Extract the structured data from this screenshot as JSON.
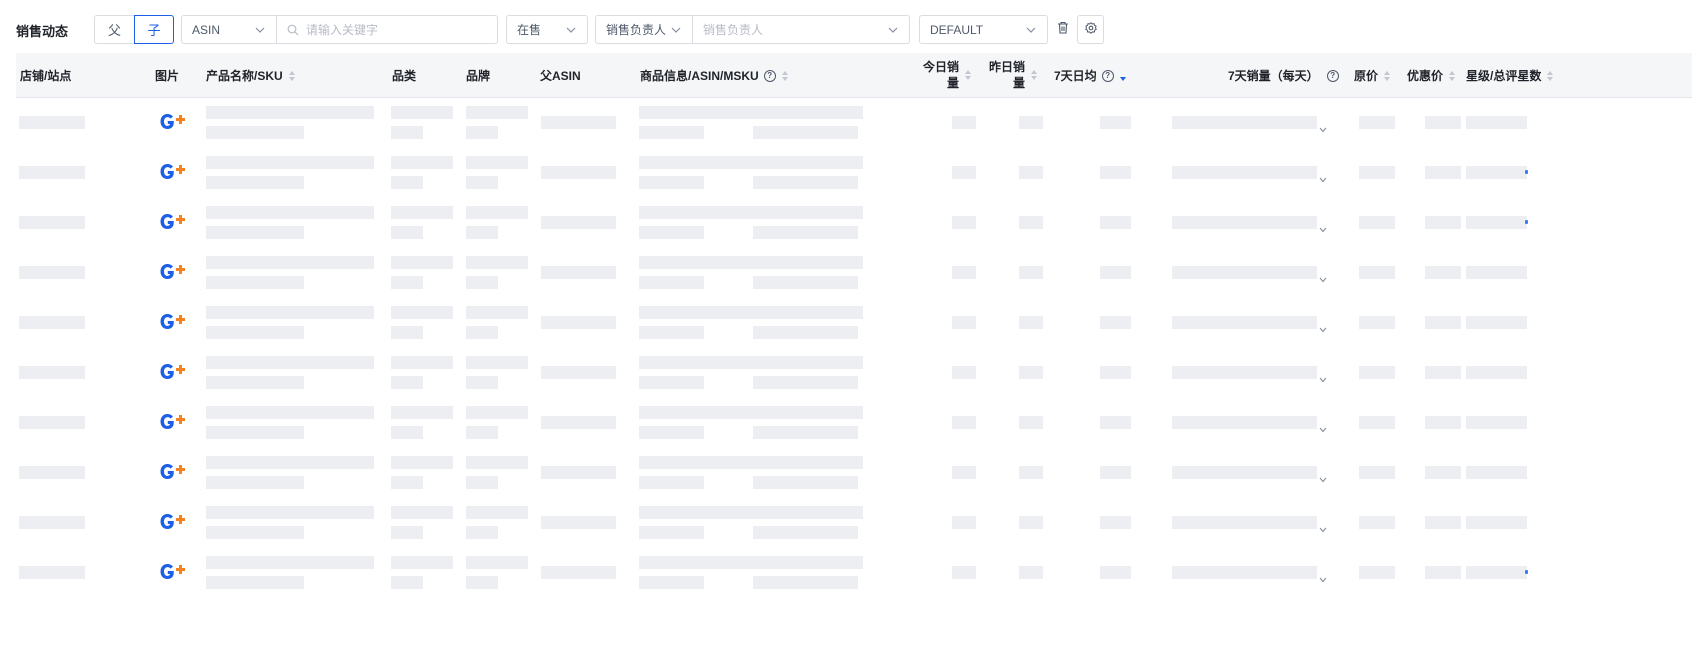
{
  "page": {
    "title": "销售动态"
  },
  "toolbar": {
    "parent_label": "父",
    "child_label": "子",
    "asin_select": "ASIN",
    "search_placeholder": "请输入关键字",
    "status_select": "在售",
    "owner_type_select": "销售负责人",
    "owner_placeholder": "销售负责人",
    "view_select": "DEFAULT"
  },
  "icons": {
    "trash": "trash-icon",
    "gear": "gear-icon",
    "search": "search-icon",
    "chevron": "chevron-down-icon",
    "help": "question-circle-icon",
    "sort": "sort-caret-icon"
  },
  "colors": {
    "accent": "#1d5fe6",
    "logo_orange": "#f58220",
    "skeleton": "#edeef2"
  },
  "table": {
    "columns": [
      {
        "key": "store",
        "label": "店铺/站点"
      },
      {
        "key": "image",
        "label": "图片"
      },
      {
        "key": "name",
        "label": "产品名称/SKU",
        "sortable": true
      },
      {
        "key": "category",
        "label": "品类"
      },
      {
        "key": "brand",
        "label": "品牌"
      },
      {
        "key": "parent_asin",
        "label": "父ASIN"
      },
      {
        "key": "product_info",
        "label": "商品信息/ASIN/MSKU",
        "help": true,
        "sortable": true
      },
      {
        "key": "today_sales_1",
        "label": "今日销",
        "sortable": true
      },
      {
        "key": "today_sales_2",
        "label": "量"
      },
      {
        "key": "yesterday_sales_1",
        "label": "昨日销",
        "sortable": true
      },
      {
        "key": "yesterday_sales_2",
        "label": "量"
      },
      {
        "key": "avg7",
        "label": "7天日均",
        "help": true,
        "sortable": true,
        "sort_state": "desc"
      },
      {
        "key": "daily7",
        "label": "7天销量（每天）",
        "help": true
      },
      {
        "key": "price",
        "label": "原价",
        "sortable": true
      },
      {
        "key": "promo_price",
        "label": "优惠价",
        "sortable": true
      },
      {
        "key": "rating",
        "label": "星级/总评星数",
        "sortable": true
      }
    ],
    "row_count": 10,
    "row_state": "loading-skeleton"
  }
}
